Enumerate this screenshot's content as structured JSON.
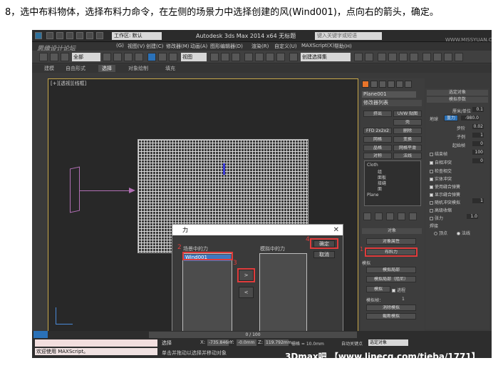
{
  "caption": "8，选中布料物体，选择布料力命令，在左侧的场景力中选择创建的风(Wind001)，点向右的箭头，确定。",
  "titlebar": {
    "workspace": "工作区: 默认",
    "title": "Autodesk 3ds Max  2014 x64      无标题",
    "search_placeholder": "键入关键字或短语",
    "watermark_top_left": "思缘设计论坛",
    "watermark_top_right": "WWW.MISSYUAN.COM"
  },
  "menu": [
    "(G)",
    "视图(V)",
    "创建(C)",
    "修改器(M)",
    "动画(A)",
    "图形编辑器(D)",
    "渲染(R)",
    "自定义(U)",
    "MAXScript(X)",
    "帮助(H)"
  ],
  "toolbar": {
    "filter": "全部",
    "view": "视图",
    "selection_set": "创建选择集"
  },
  "ribbon": {
    "tabs": [
      "建模",
      "自由形式",
      "选择",
      "对象绘制",
      "填充"
    ]
  },
  "viewport": {
    "label": "[+][透视][线框]"
  },
  "dialog": {
    "title": "力",
    "scene_forces_label": "场景中的力",
    "scene_force_item": "Wind001",
    "model_forces_label": "模拟中的力",
    "ok_label": "确定",
    "cancel_label": "取消",
    "right_arrow": ">",
    "left_arrow": "<",
    "step_numbers": [
      "2",
      "3",
      "4"
    ]
  },
  "command_panel": {
    "object_name": "Plane001",
    "modifier_list": "修改器列表",
    "buttons": [
      "挤出",
      "UVW 贴图",
      "FFD 2x2x2",
      "壳",
      "网格",
      "删除",
      "面挤",
      "变换",
      "对称",
      "网格平滑",
      "晶格",
      "法线"
    ],
    "stack": [
      "Cloth",
      "组",
      "面板",
      "接缝",
      "面",
      "Plane"
    ],
    "object_section": "对象",
    "object_props": "对象属性",
    "cloth_forces": "布料力",
    "simulate_section": "模拟",
    "sim_local": "模拟局部",
    "sim_local_damped": "模拟局部（阻尼）",
    "simulate": "模拟",
    "progress": "进程",
    "sim_frame": "模拟帧：",
    "sim_frame_value": "1",
    "erase_sim": "消除模拟",
    "cut_sim": "截断模拟",
    "step_number_1": "1"
  },
  "params_panel": {
    "select_object": "选定对象",
    "sim_params": "模拟参数",
    "cm_unit": "厘米/单位",
    "cm_unit_value": "0.1",
    "earth": "地球",
    "gravity": "重力",
    "gravity_value": "-980.0",
    "step": "步阶",
    "step_value": "0.02",
    "subsample": "子例",
    "subsample_value": "1",
    "start_frame": "起始帧",
    "start_frame_value": "0",
    "end_frame": "结束帧",
    "end_frame_value": "100",
    "self_collision": "自相冲突",
    "self_collision_value": "0",
    "check_intersect": "检查相交",
    "solid_collision": "实体冲突",
    "use_sewing": "使用缝合弹簧",
    "show_sewing": "显示缝合弹簧",
    "random_collision": "随机冲突模拟",
    "random_value": "1",
    "advanced_pinch": "高级收缩",
    "tension": "张力",
    "tension_value": "1.0",
    "weld": "焊接",
    "weld_vertex": "顶点",
    "weld_normal": "法线"
  },
  "bottom": {
    "time": "0 / 100",
    "selection": "选择",
    "x_label": "X:",
    "x_value": "-735.846m",
    "y_label": "Y:",
    "y_value": "-0.0mm",
    "z_label": "Z:",
    "z_value": "119.792mm",
    "grid": "栅格 = 10.0mm",
    "autokey": "自动关键点",
    "selected_obj": "选定对象",
    "status": "单击并拖动以选择并移动对象",
    "maxscript": "欢迎使用 MAXScript。",
    "watermark": "3Dmax吧 【www.linecg.com/tieba/1771】"
  },
  "colors": {
    "highlight": "#e03c3c",
    "accent": "#2a71b8",
    "selected_item": "#3f78c0"
  }
}
